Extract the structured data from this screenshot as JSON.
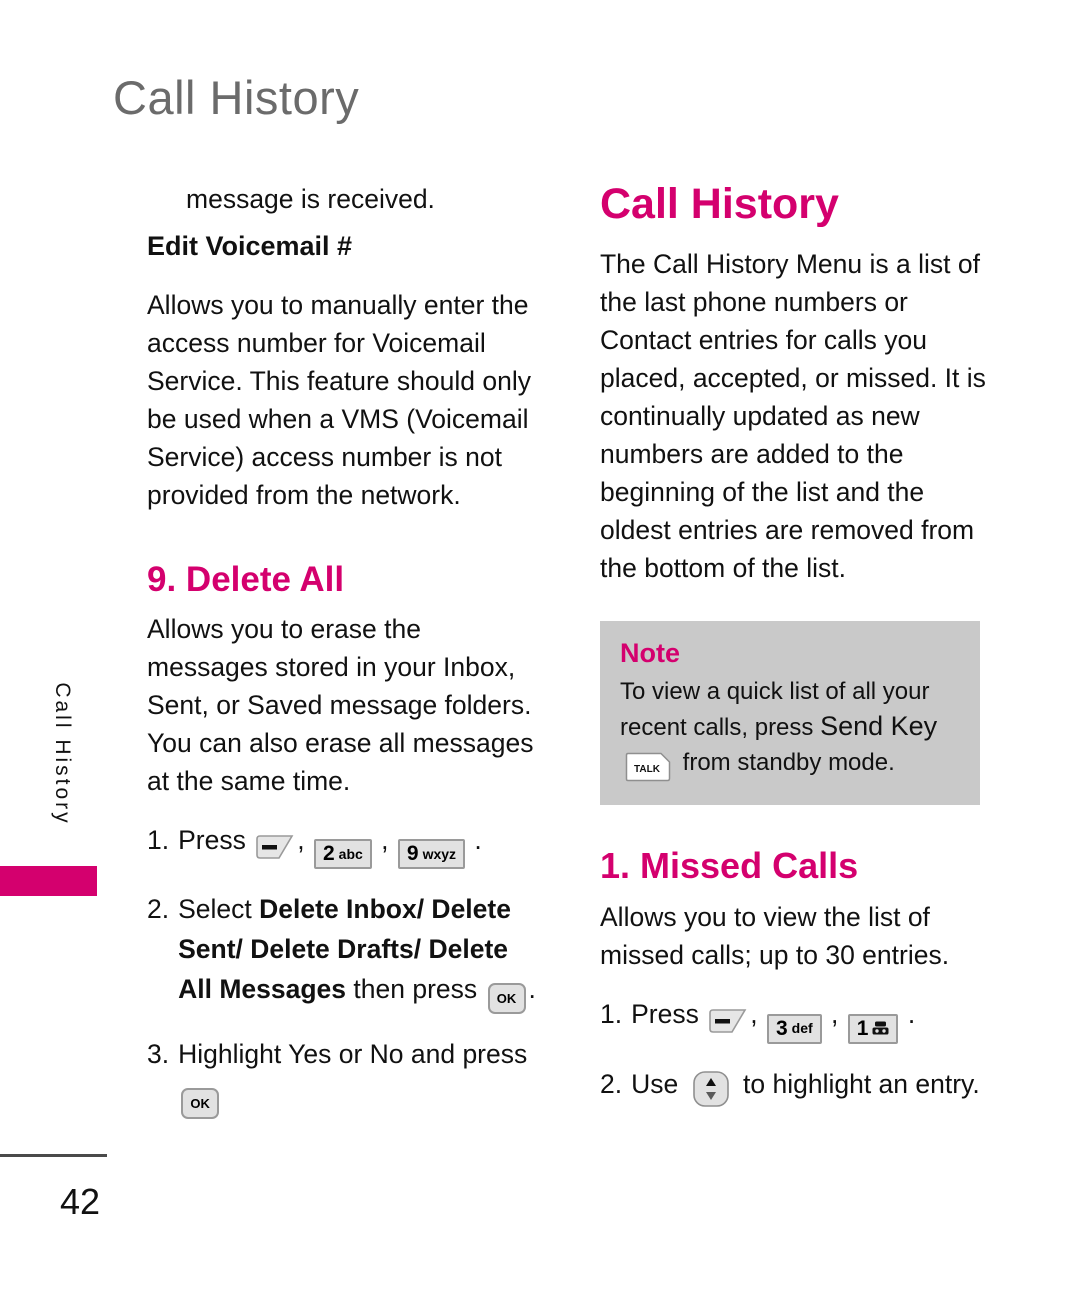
{
  "page": {
    "running_header": "Call History",
    "side_tab_label": "Call History",
    "page_number": "42",
    "accent_color": "#d4006e",
    "header_color": "#6b6b6b",
    "note_bg_color": "#c9c9c9"
  },
  "left_column": {
    "continued_line": "message is received.",
    "edit_voicemail": {
      "heading": "Edit Voicemail #",
      "body": "Allows you to manually enter the access number for Voicemail Service. This feature should only be used when a VMS (Voicemail Service) access number is not provided from the network."
    },
    "delete_all": {
      "heading": "9. Delete All",
      "body": "Allows you to erase the messages stored in your Inbox, Sent, or Saved message folders. You can also erase all messages at the same time.",
      "steps": [
        {
          "number": "1.",
          "pre": "Press",
          "keys": [
            "menu-soft-key",
            "2 abc",
            "9 wxyz"
          ],
          "post": "."
        },
        {
          "number": "2.",
          "pre": "Select",
          "bold_1": "Delete Inbox/ Delete Sent/ Delete Drafts/ Delete All Messages",
          "mid": "then press",
          "keys": [
            "OK"
          ],
          "post": "."
        },
        {
          "number": "3.",
          "pre": "Highlight Yes or No and press",
          "keys": [
            "OK"
          ],
          "post": ""
        }
      ]
    }
  },
  "right_column": {
    "call_history": {
      "heading": "Call History",
      "body": "The Call History Menu is a list of the last phone numbers or Contact entries for calls you placed, accepted, or missed. It is continually updated as new numbers are added to the beginning of the list and the oldest entries are removed from the bottom of the list."
    },
    "note": {
      "title": "Note",
      "line_1": "To view a quick list of all your",
      "line_2_pre": "recent calls, press",
      "line_2_emphasis": "Send Key",
      "key_label": "TALK",
      "line_3": "from standby mode."
    },
    "missed_calls": {
      "heading": "1. Missed Calls",
      "body": "Allows you to view the list of missed calls; up to 30 entries.",
      "steps": [
        {
          "number": "1.",
          "pre": "Press",
          "keys": [
            "menu-soft-key",
            "3 def",
            "1 voicemail"
          ],
          "post": "."
        },
        {
          "number": "2.",
          "pre": "Use",
          "keys": [
            "nav-up-down"
          ],
          "post": "to highlight an entry."
        }
      ]
    }
  },
  "keys": {
    "k2": {
      "digit": "2",
      "letters": "abc"
    },
    "k9": {
      "digit": "9",
      "letters": "wxyz"
    },
    "k3": {
      "digit": "3",
      "letters": "def"
    },
    "k1": {
      "digit": "1",
      "letters": ""
    },
    "ok": {
      "label": "OK"
    },
    "talk": {
      "label": "TALK"
    }
  }
}
